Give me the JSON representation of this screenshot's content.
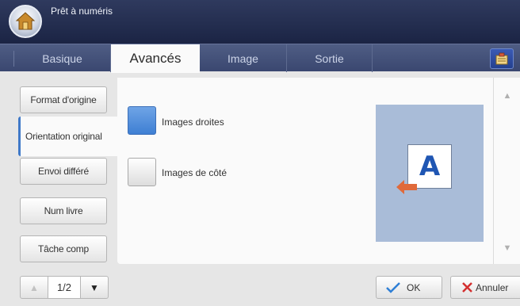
{
  "status": {
    "text": "Prêt à numéris",
    "home_icon": "home-icon"
  },
  "tabs": [
    {
      "label": "Basique"
    },
    {
      "label": "Avancés",
      "active": true
    },
    {
      "label": "Image"
    },
    {
      "label": "Sortie"
    }
  ],
  "tabbar": {
    "right_icon": "clipboard-icon"
  },
  "sidebar": {
    "items": [
      {
        "label": "Format d'origine"
      },
      {
        "label": "Orientation original",
        "active": true
      },
      {
        "label": "Envoi différé"
      },
      {
        "label": "Num livre"
      },
      {
        "label": "Tâche comp"
      }
    ]
  },
  "options": [
    {
      "label": "Images droites",
      "selected": true
    },
    {
      "label": "Images de côté",
      "selected": false
    }
  ],
  "preview": {
    "letter": "A",
    "arrow_color": "#e06a3b",
    "letter_color": "#1f56b3"
  },
  "pager": {
    "text": "1/2"
  },
  "actions": {
    "ok_label": "OK",
    "cancel_label": "Annuler"
  },
  "colors": {
    "accent": "#3f79c8",
    "header_dark": "#1b2444",
    "tabbar": "#4f5d84"
  }
}
